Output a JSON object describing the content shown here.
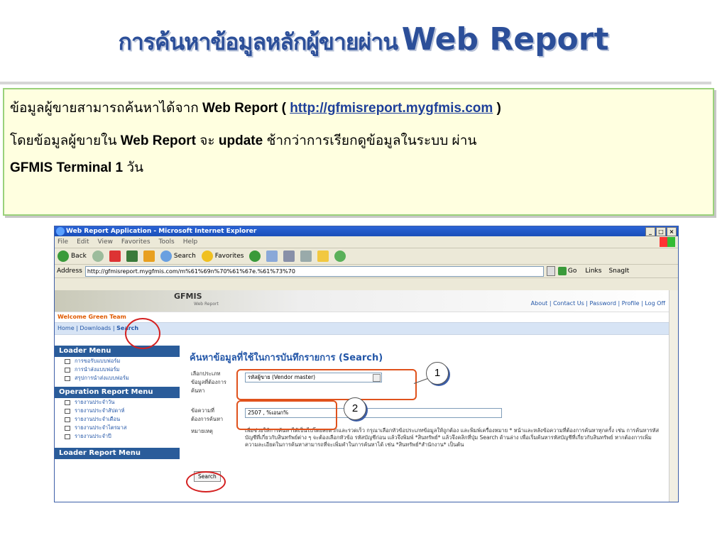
{
  "slide": {
    "title_thai": "การค้นหาข้อมูลหลักผู้ขายผ่าน",
    "title_en": "Web Report",
    "info_line1_thai": "ข้อมูลผู้ขายสามารถค้นหาได้จาก",
    "info_line1_en": "Web Report (",
    "info_link": "http://gfmisreport.mygfmis.com",
    "info_line1_close": ")",
    "info_line2_thai_a": "โดยข้อมูลผู้ขายใน",
    "info_line2_en_a": "Web Report",
    "info_line2_thai_b": "จะ",
    "info_line2_en_b": "update",
    "info_line2_thai_c": "ช้ากว่าการเรียกดูข้อมูลในระบบ ผ่าน",
    "info_line3_en": "GFMIS Terminal 1",
    "info_line3_thai": "วัน"
  },
  "window": {
    "title": "Web Report Application - Microsoft Internet Explorer",
    "controls": [
      "_",
      "□",
      "×"
    ],
    "menu": [
      "File",
      "Edit",
      "View",
      "Favorites",
      "Tools",
      "Help"
    ],
    "toolbar": {
      "back": "Back",
      "search": "Search",
      "favorites": "Favorites"
    },
    "address_label": "Address",
    "address_value": "http://gfmisreport.mygfmis.com/m%61%69n%70%61%67e.%61%73%70",
    "go": "Go",
    "links": "Links",
    "snagit": "SnagIt"
  },
  "site": {
    "logo": "GFMIS",
    "logo_sub": "Web Report",
    "top_links": "About | Contact Us | Password | Profile | Log Off",
    "welcome": "Welcome Green Team",
    "nav_home": "Home",
    "nav_downloads": "Downloads",
    "nav_search": "Search"
  },
  "left_menu": {
    "loader_title": "Loader Menu",
    "loader_items": [
      "การขอรับแบบฟอร์ม",
      "การนำส่งแบบฟอร์ม",
      "สรุปการนำส่งแบบฟอร์ม"
    ],
    "operation_title": "Operation Report Menu",
    "operation_items": [
      "รายงานประจำวัน",
      "รายงานประจำสัปดาห์",
      "รายงานประจำเดือน",
      "รายงานประจำไตรมาส",
      "รายงานประจำปี"
    ],
    "loader_report_title": "Loader Report Menu"
  },
  "form": {
    "heading": "ค้นหาข้อมูลที่ใช้ในการบันทึกรายการ (Search)",
    "type_label": "เลือกประเภทข้อมูลที่ต้องการค้นหา",
    "type_value": "รหัสผู้ขาย (Vendor master)",
    "text_label": "ข้อความที่ต้องการค้นหา",
    "text_value": "2507 , %เอนก%",
    "note_label": "หมายเหตุ",
    "note_text": "เพื่อช่วยให้การค้นหาได้เป็นไปโดยสะดวกและรวดเร็ว กรุณาเลือกหัวข้อประเภทข้อมูลให้ถูกต้อง และพิมพ์เครื่องหมาย * หน้าและหลังข้อความที่ต้องการค้นหาทุกครั้ง เช่น การค้นหารหัสบัญชีที่เกี่ยวกับสินทรัพย์ต่าง ๆ จะต้องเลือกหัวข้อ รหัสบัญชีก่อน แล้วจึงพิมพ์ *สินทรัพย์* แล้วจึงคลิกที่ปุ่ม Search ด้านล่าง เพื่อเริ่มค้นหารหัสบัญชีที่เกี่ยวกับสินทรัพย์ หากต้องการเพิ่มความละเอียดในการค้นหาสามารถที่จะเพิ่มคำในการค้นหาได้ เช่น *สินทรัพย์*สำนักงาน* เป็นต้น",
    "search_button": "Search"
  },
  "callouts": {
    "one": "1",
    "two": "2"
  },
  "colors": {
    "title_blue": "#2c4f99",
    "callout_red": "#e0521c",
    "menu_header": "#2a5c9a",
    "info_bg": "#ffffe0"
  }
}
